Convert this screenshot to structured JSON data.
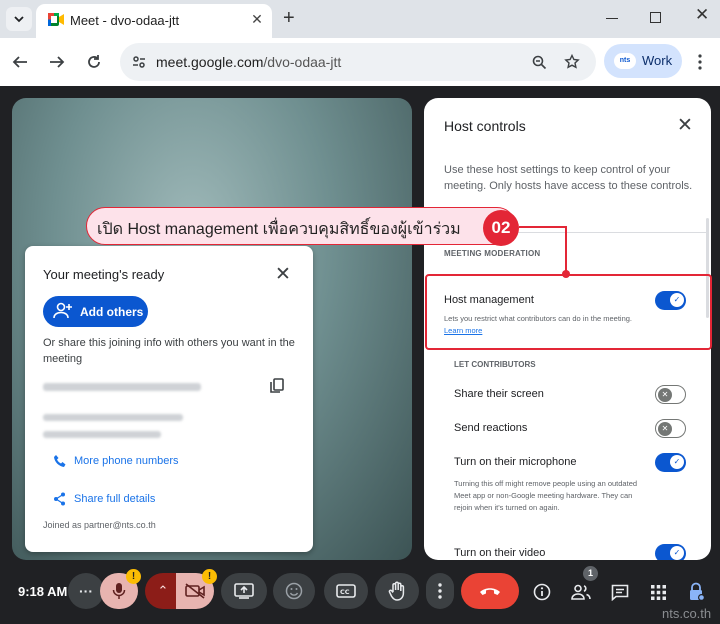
{
  "browser": {
    "tab_title": "Meet - dvo-odaa-jtt",
    "url_host": "meet.google.com",
    "url_path": "/dvo-odaa-jtt",
    "profile_chip": "nts",
    "profile_label": "Work"
  },
  "meeting_ready": {
    "title": "Your meeting's ready",
    "add_others": "Add others",
    "share_text": "Or share this joining info with others you want in the meeting",
    "more_phone": "More phone numbers",
    "share_details": "Share full details",
    "joined_as": "Joined as partner@nts.co.th"
  },
  "host_controls": {
    "title": "Host controls",
    "description": "Use these host settings to keep control of your meeting. Only hosts have access to these controls.",
    "section_moderation": "MEETING MODERATION",
    "host_management": {
      "label": "Host management",
      "sub": "Lets you restrict what contributors can do in the meeting.",
      "learn_more": "Learn more",
      "on": true
    },
    "section_contributors": "LET CONTRIBUTORS",
    "share_screen": {
      "label": "Share their screen",
      "on": false
    },
    "send_reactions": {
      "label": "Send reactions",
      "on": false
    },
    "microphone": {
      "label": "Turn on their microphone",
      "sub": "Turning this off might remove people using an outdated Meet app or non-Google meeting hardware. They can rejoin when it's turned on again.",
      "on": true
    },
    "video": {
      "label": "Turn on their video",
      "on": true
    }
  },
  "annotation": {
    "text": "เปิด Host management เพื่อควบคุมสิทธิ์ของผู้เข้าร่วม",
    "step": "02",
    "color": "#e32636"
  },
  "controls": {
    "time": "9:18 AM",
    "people_count": "1",
    "end_call_color": "#ea4335",
    "accent": "#0b57d0"
  },
  "watermark": "nts.co.th"
}
